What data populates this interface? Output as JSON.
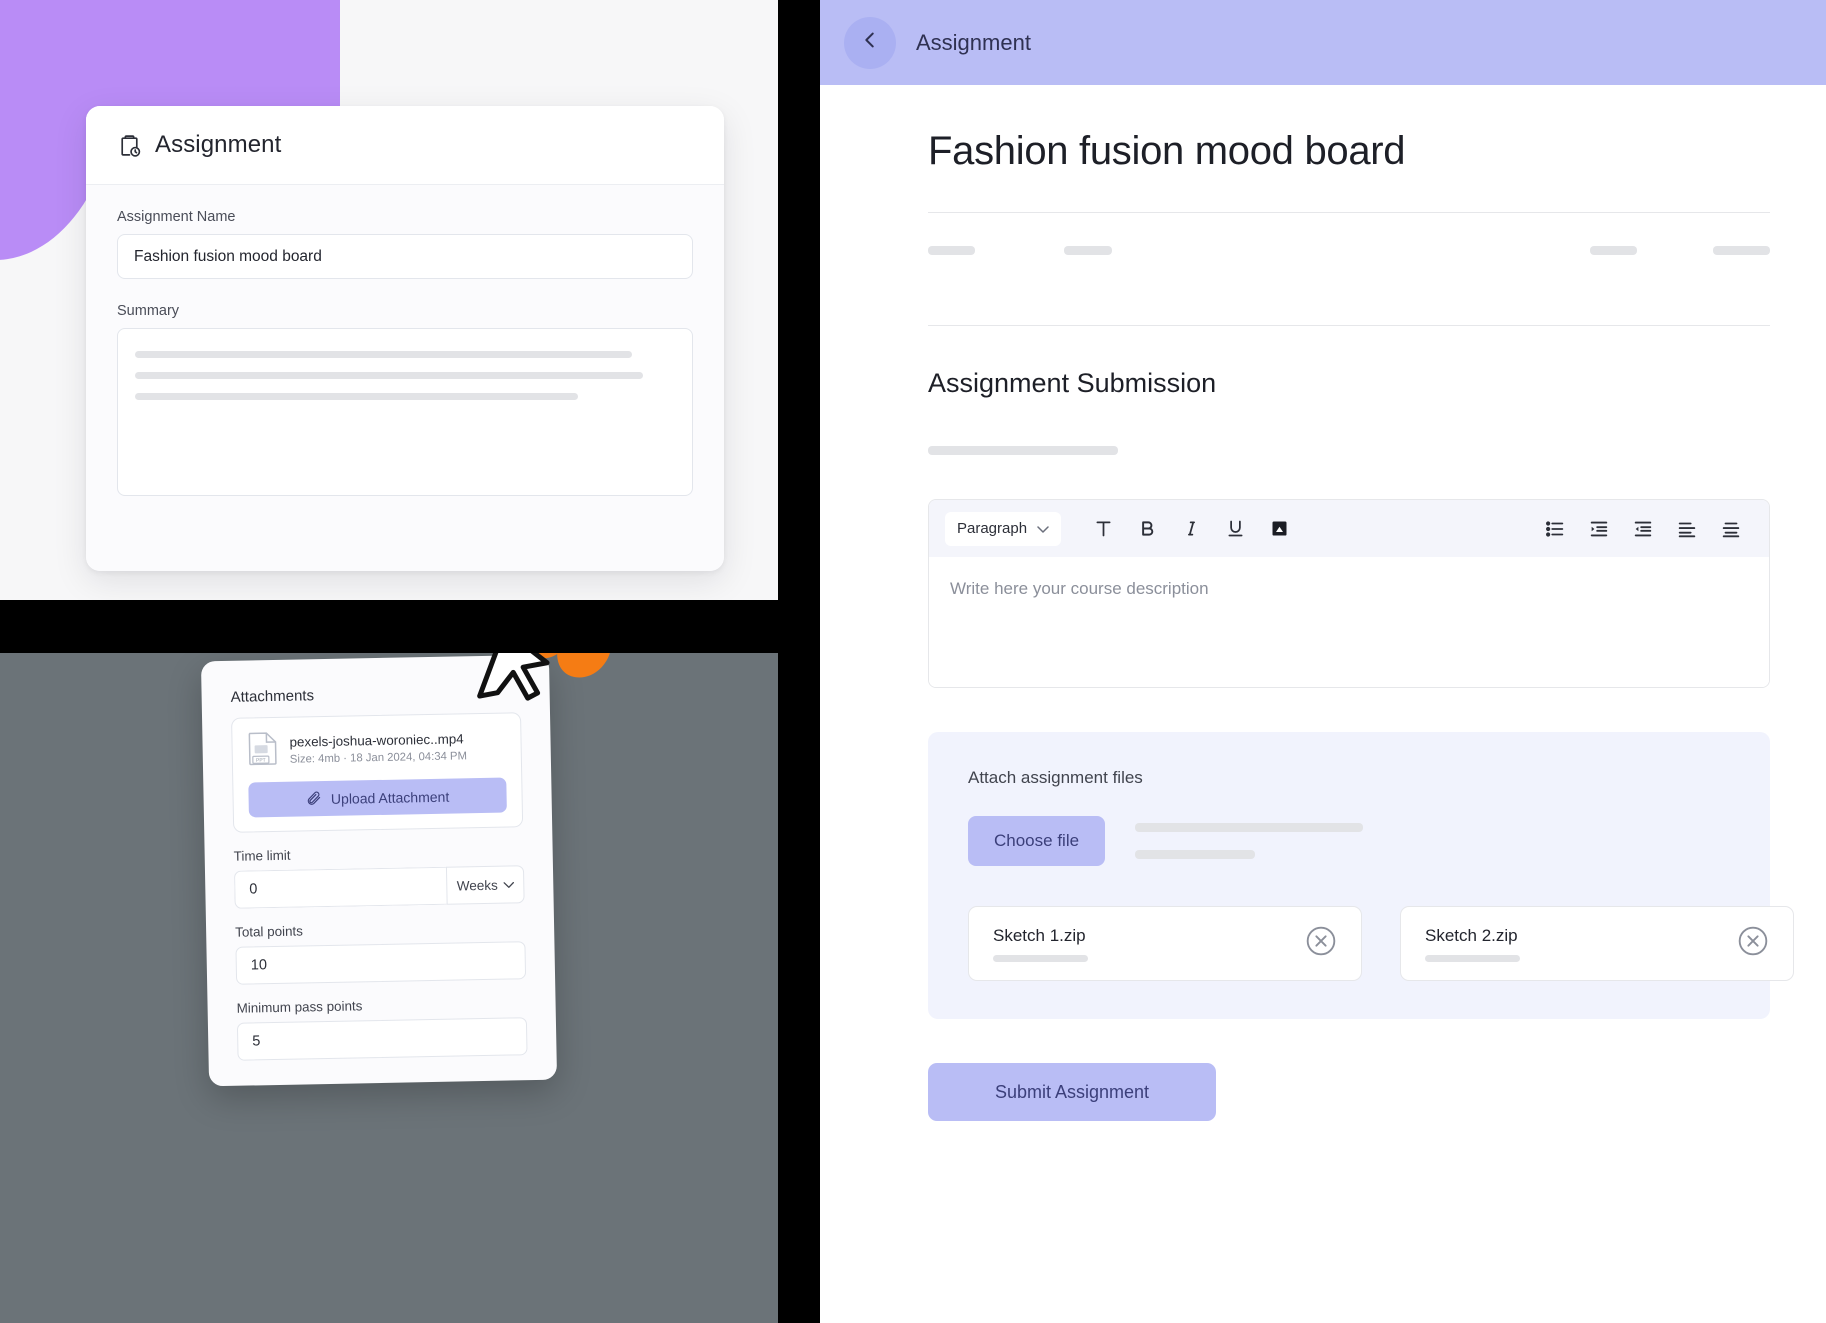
{
  "left_top_card": {
    "header_title": "Assignment",
    "header_icon": "clipboard-clock-icon",
    "name_label": "Assignment Name",
    "name_value": "Fashion fusion mood board",
    "summary_label": "Summary"
  },
  "left_bottom_card": {
    "attachments_label": "Attachments",
    "file": {
      "icon": "ppt-file-icon",
      "name": "pexels-joshua-woroniec..mp4",
      "size": "Size: 4mb",
      "separator": "·",
      "date": "18 Jan 2024, 04:34 PM"
    },
    "upload_button": "Upload Attachment",
    "upload_icon": "paperclip-icon",
    "time_limit_label": "Time limit",
    "time_limit_value": "0",
    "time_limit_unit": "Weeks",
    "total_points_label": "Total points",
    "total_points_value": "10",
    "min_pass_label": "Minimum pass points",
    "min_pass_value": "5"
  },
  "right_panel": {
    "header": {
      "back_icon": "chevron-left-icon",
      "title": "Assignment"
    },
    "assignment_title": "Fashion fusion mood board",
    "section_title": "Assignment Submission",
    "editor": {
      "paragraph_label": "Paragraph",
      "dropdown_icon": "chevron-down-icon",
      "tools": [
        {
          "name": "text-color-icon",
          "glyph": "T"
        },
        {
          "name": "bold-icon",
          "glyph": "B"
        },
        {
          "name": "italic-icon",
          "glyph": "I"
        },
        {
          "name": "underline-icon",
          "glyph": "U"
        },
        {
          "name": "image-icon",
          "glyph": "▲"
        }
      ],
      "tools_right": [
        {
          "name": "bullet-list-icon"
        },
        {
          "name": "outdent-icon"
        },
        {
          "name": "indent-icon"
        },
        {
          "name": "align-left-icon"
        },
        {
          "name": "align-center-icon"
        }
      ],
      "placeholder": "Write here your course description"
    },
    "attach_section": {
      "title": "Attach assignment files",
      "choose_button": "Choose file",
      "files": [
        {
          "name": "Sketch 1.zip",
          "remove_icon": "close-circle-icon"
        },
        {
          "name": "Sketch 2.zip",
          "remove_icon": "close-circle-icon"
        }
      ]
    },
    "submit_button": "Submit Assignment"
  },
  "colors": {
    "accent": "#b9bdf5",
    "accent_text": "#3b3f7a",
    "blob_purple": "#b98cf6",
    "butterfly_orange": "#f57c14",
    "panel_tint": "#f1f3fd",
    "backdrop_gray": "#6b7378"
  }
}
